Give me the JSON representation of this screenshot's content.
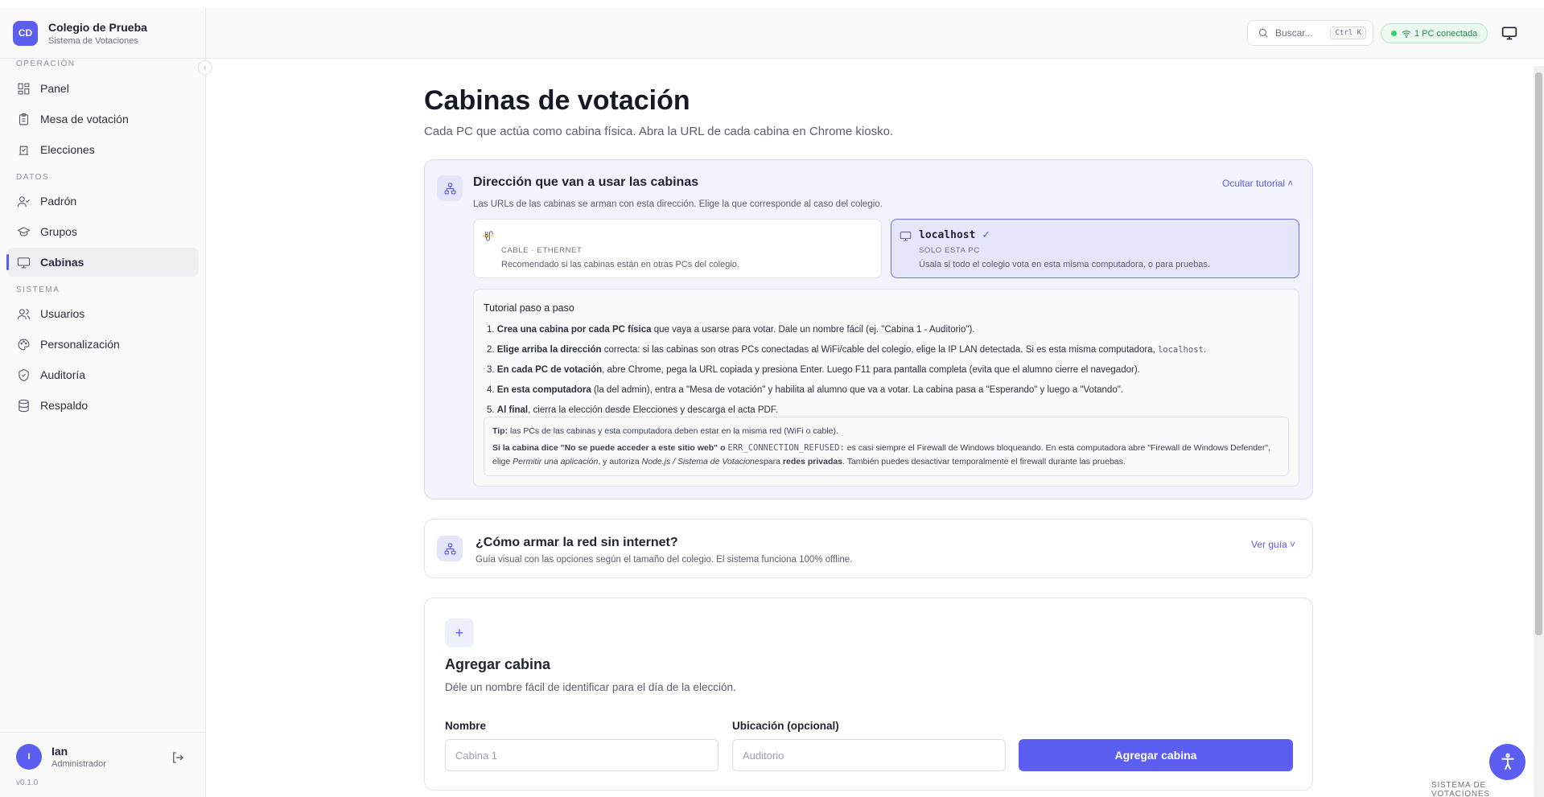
{
  "brand": {
    "initials": "CD",
    "name": "Colegio de Prueba",
    "subtitle": "Sistema de Votaciones"
  },
  "sidebar": {
    "sections": [
      "OPERACIÓN",
      "DATOS",
      "SISTEMA"
    ],
    "items": [
      {
        "label": "Panel",
        "icon": "grid-icon"
      },
      {
        "label": "Mesa de votación",
        "icon": "clipboard-icon"
      },
      {
        "label": "Elecciones",
        "icon": "ballot-icon"
      },
      {
        "label": "Padrón",
        "icon": "user-list-icon"
      },
      {
        "label": "Grupos",
        "icon": "graduation-cap-icon"
      },
      {
        "label": "Cabinas",
        "icon": "monitor-icon",
        "active": true
      },
      {
        "label": "Usuarios",
        "icon": "users-icon"
      },
      {
        "label": "Personalización",
        "icon": "palette-icon"
      },
      {
        "label": "Auditoría",
        "icon": "shield-icon"
      },
      {
        "label": "Respaldo",
        "icon": "database-icon"
      }
    ]
  },
  "user": {
    "initial": "I",
    "name": "Ian",
    "role": "Administrador"
  },
  "version": "v0.1.0",
  "topbar": {
    "search_placeholder": "Buscar...",
    "search_shortcut": "Ctrl K",
    "status": "1 PC conectada",
    "accent": "#5b5ef0"
  },
  "page": {
    "title": "Cabinas de votación",
    "subtitle": "Cada PC que actúa como cabina física. Abra la URL de cada cabina en Chrome kiosko."
  },
  "direction_card": {
    "title": "Dirección que van a usar las cabinas",
    "toggle": "Ocultar tutorial",
    "description": "Las URLs de las cabinas se arman con esta dirección. Elige la que corresponde al caso del colegio.",
    "options": [
      {
        "tag": "CABLE · ETHERNET",
        "desc": "Recomendado si las cabinas están en otras PCs del colegio."
      },
      {
        "title": "localhost",
        "tag": "SOLO ESTA PC",
        "desc": "Úsala si todo el colegio vota en esta misma computadora, o para pruebas."
      }
    ]
  },
  "tutorial": {
    "title": "Tutorial paso a paso",
    "steps": [
      {
        "n": "1.",
        "b": "Crea una cabina por cada PC física",
        "t": " que vaya a usarse para votar. Dale un nombre fácil (ej. \"Cabina 1 - Auditorio\")."
      },
      {
        "n": "2.",
        "b": "Elige arriba la dirección",
        "t": " correcta: si las cabinas son otras PCs conectadas al WiFi/cable del colegio, elige la IP LAN detectada. Si es esta misma computadora, ",
        "m": "localhost",
        "t2": "."
      },
      {
        "n": "3.",
        "b": "En cada PC de votación",
        "t": ", abre Chrome, pega la URL copiada y presiona Enter. Luego F11 para pantalla completa (evita que el alumno cierre el navegador)."
      },
      {
        "n": "4.",
        "b": "En esta computadora",
        "t": " (la del admin), entra a \"Mesa de votación\" y habilita al alumno que va a votar. La cabina pasa a \"Esperando\" y luego a \"Votando\"."
      },
      {
        "n": "5.",
        "b": "Al final",
        "t": ", cierra la elección desde Elecciones y descarga el acta PDF."
      }
    ],
    "tip_label": "Tip:",
    "tip_text": " las PCs de las cabinas y esta computadora deben estar en la misma red (WiFi o cable).",
    "warn_label": "Si la cabina dice \"No se puede acceder a este sitio web\" o",
    "warn_code": "ERR_CONNECTION_REFUSED:",
    "warn_text1": " es casi siempre el Firewall de Windows bloqueando. En esta computadora abre \"Firewall de Windows Defender\", elige ",
    "warn_em1": "Permitir una aplicación",
    "warn_text2": ", y autoriza ",
    "warn_em2": "Node.js / Sistema de Votaciones",
    "warn_text3": "para ",
    "warn_b": "redes privadas",
    "warn_text4": ". También puedes desactivar temporalmente el firewall durante las pruebas."
  },
  "network_card": {
    "title": "¿Cómo armar la red sin internet?",
    "description": "Guía visual con las opciones según el tamaño del colegio. El sistema funciona 100% offline.",
    "toggle": "Ver guía"
  },
  "add_card": {
    "plus": "+",
    "title": "Agregar cabina",
    "description": "Déle un nombre fácil de identificar para el día de la elección.",
    "name_label": "Nombre",
    "name_placeholder": "Cabina 1",
    "location_label": "Ubicación (opcional)",
    "location_placeholder": "Auditorio",
    "submit": "Agregar cabina"
  },
  "footer_tag": "SISTEMA DE VOTACIONES"
}
